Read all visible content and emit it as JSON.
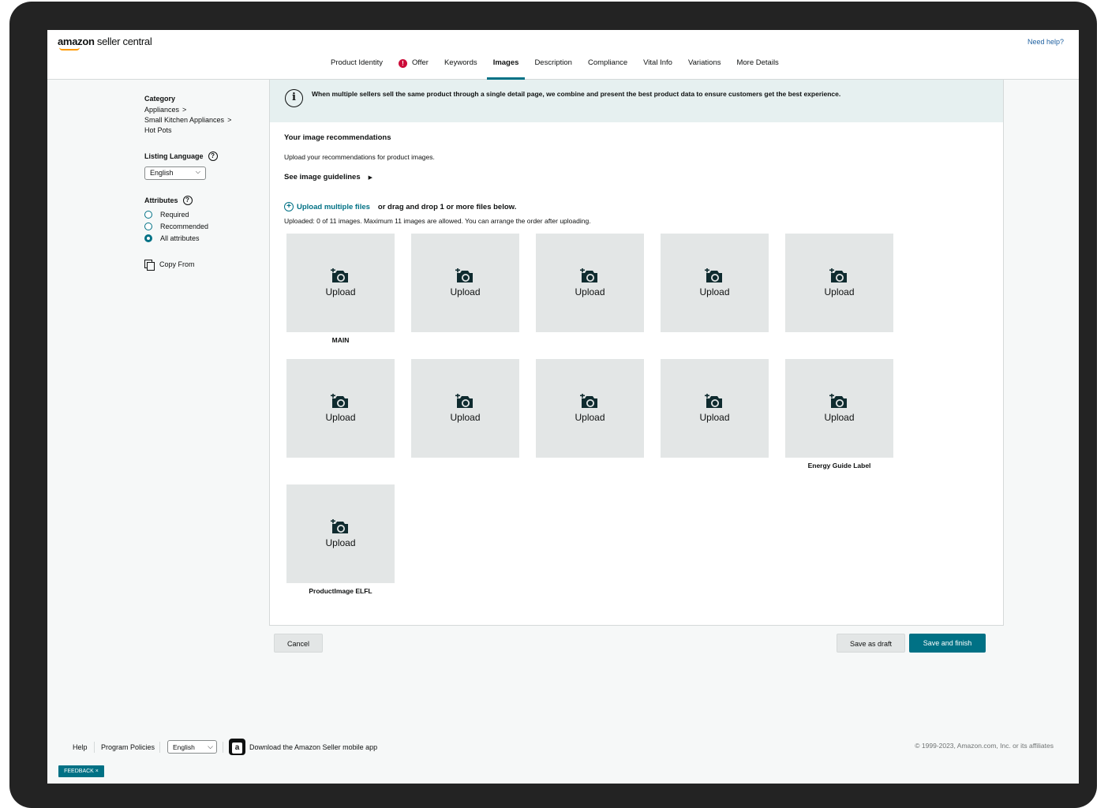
{
  "header": {
    "logo_brand": "amazon",
    "logo_suffix": " seller central",
    "need_help": "Need help?",
    "tabs": [
      {
        "label": "Product Identity"
      },
      {
        "label": "Offer",
        "error": "!"
      },
      {
        "label": "Keywords"
      },
      {
        "label": "Images",
        "active": true
      },
      {
        "label": "Description"
      },
      {
        "label": "Compliance"
      },
      {
        "label": "Vital Info"
      },
      {
        "label": "Variations"
      },
      {
        "label": "More Details"
      }
    ]
  },
  "sidebar": {
    "category_heading": "Category",
    "crumbs": [
      "Appliances",
      "Small Kitchen Appliances",
      "Hot Pots"
    ],
    "crumb_chevron": ">",
    "listing_language_heading": "Listing Language",
    "help_glyph": "?",
    "language_value": "English",
    "language_caret": "⌵",
    "attributes_heading": "Attributes",
    "attribute_options": [
      {
        "label": "Required",
        "selected": false
      },
      {
        "label": "Recommended",
        "selected": false
      },
      {
        "label": "All attributes",
        "selected": true
      }
    ],
    "copy_from": "Copy From"
  },
  "main": {
    "info_icon": "i",
    "info_text": "When multiple sellers sell the same product through a single detail page, we combine and present the best product data to ensure customers get the best experience.",
    "section_title": "Your image recommendations",
    "section_subtitle": "Upload your recommendations for product images.",
    "guidelines_link": "See image guidelines",
    "guidelines_arrow": "▶",
    "plus_glyph": "+",
    "upload_multiple": "Upload multiple files",
    "drag_text": "or drag and drop 1 or more files below.",
    "count_text": "Uploaded: 0 of 11 images. Maximum 11 images are allowed. You can arrange the order after uploading.",
    "tile_label": "Upload",
    "tile_icon": "camera-plus-icon",
    "tiles": [
      {
        "caption": "MAIN"
      },
      {
        "caption": ""
      },
      {
        "caption": ""
      },
      {
        "caption": ""
      },
      {
        "caption": ""
      },
      {
        "caption": ""
      },
      {
        "caption": ""
      },
      {
        "caption": ""
      },
      {
        "caption": ""
      },
      {
        "caption": "Energy Guide Label"
      },
      {
        "caption": "ProductImage ELFL"
      }
    ]
  },
  "actions": {
    "cancel": "Cancel",
    "save_draft": "Save as draft",
    "save_finish": "Save and finish"
  },
  "footer": {
    "help": "Help",
    "program_policies": "Program Policies",
    "language": "English",
    "app_glyph": "a",
    "app_text": "Download the Amazon Seller mobile app",
    "copyright": "© 1999-2023, Amazon.com, Inc. or its affiliates",
    "feedback": "FEEDBACK ×"
  },
  "colors": {
    "accent": "#007185",
    "error": "#cc0c39",
    "info_bg": "#e6f0f0",
    "tile_bg": "#e3e6e6",
    "brand_smile": "#ff9900"
  }
}
